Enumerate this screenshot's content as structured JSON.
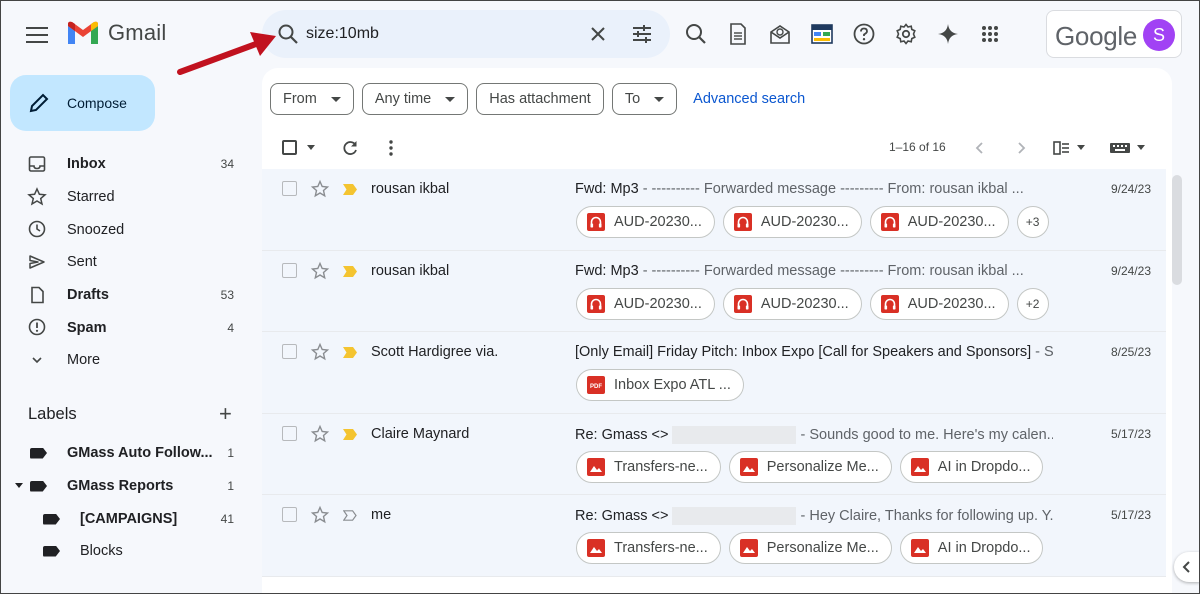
{
  "app": {
    "name": "Gmail"
  },
  "search": {
    "value": "size:10mb"
  },
  "account": {
    "brand": "Google",
    "avatar_letter": "S",
    "avatar_color": "#a142f4"
  },
  "compose": {
    "label": "Compose"
  },
  "nav": [
    {
      "label": "Inbox",
      "count": "34",
      "bold": true,
      "icon": "inbox-icon"
    },
    {
      "label": "Starred",
      "count": "",
      "bold": false,
      "icon": "star-icon"
    },
    {
      "label": "Snoozed",
      "count": "",
      "bold": false,
      "icon": "clock-icon"
    },
    {
      "label": "Sent",
      "count": "",
      "bold": false,
      "icon": "send-icon"
    },
    {
      "label": "Drafts",
      "count": "53",
      "bold": true,
      "icon": "draft-icon"
    },
    {
      "label": "Spam",
      "count": "4",
      "bold": true,
      "icon": "spam-icon"
    },
    {
      "label": "More",
      "count": "",
      "bold": false,
      "icon": "chevron-down-icon"
    }
  ],
  "labels": {
    "heading": "Labels",
    "items": [
      {
        "label": "GMass Auto Follow...",
        "count": "1"
      },
      {
        "label": "GMass Reports",
        "count": "1"
      },
      {
        "label": "[CAMPAIGNS]",
        "count": "41"
      },
      {
        "label": "Blocks",
        "count": ""
      }
    ]
  },
  "filters": {
    "chips": [
      "From",
      "Any time",
      "Has attachment",
      "To"
    ],
    "advanced": "Advanced search"
  },
  "pager": {
    "range": "1–16 of 16"
  },
  "emails": [
    {
      "sender": "rousan ikbal",
      "subject": "Fwd: Mp3",
      "snippet": " - ---------- Forwarded message --------- From: rousan ikbal ...",
      "date": "9/24/23",
      "attachments": [
        "AUD-20230...",
        "AUD-20230...",
        "AUD-20230..."
      ],
      "att_type": "audio",
      "more": "+3"
    },
    {
      "sender": "rousan ikbal",
      "subject": "Fwd: Mp3",
      "snippet": " - ---------- Forwarded message --------- From: rousan ikbal ...",
      "date": "9/24/23",
      "attachments": [
        "AUD-20230...",
        "AUD-20230...",
        "AUD-20230..."
      ],
      "att_type": "audio",
      "more": "+2"
    },
    {
      "sender": "Scott Hardigree via.",
      "subject": "[Only Email] Friday Pitch: Inbox Expo [Call for Speakers and Sponsors]",
      "snippet": " - S...",
      "date": "8/25/23",
      "attachments": [
        "Inbox Expo ATL ..."
      ],
      "att_type": "pdf",
      "more": ""
    },
    {
      "sender": "Claire Maynard",
      "subject": "Re: Gmass <>",
      "snippet": "- Sounds good to me. Here's my calen...",
      "date": "5/17/23",
      "attachments": [
        "Transfers-ne...",
        "Personalize Me...",
        "AI in Dropdo..."
      ],
      "att_type": "image",
      "more": ""
    },
    {
      "sender": "me",
      "subject": "Re: Gmass <>",
      "snippet": "- Hey Claire, Thanks for following up. Y...",
      "date": "5/17/23",
      "attachments": [
        "Transfers-ne...",
        "Personalize Me...",
        "AI in Dropdo..."
      ],
      "att_type": "image",
      "more": ""
    }
  ],
  "colors": {
    "accent": "#0b57d0",
    "compose_bg": "#c2e7ff",
    "search_bg": "#eaf1fb",
    "attachment_red": "#d93025",
    "important_yellow": "#f4c430",
    "annotation_arrow": "#c1121f"
  }
}
